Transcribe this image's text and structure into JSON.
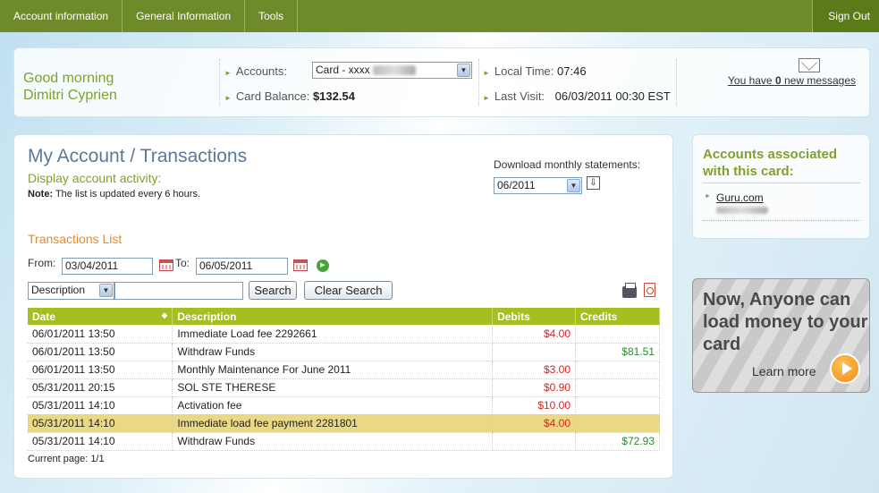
{
  "topnav": {
    "items": [
      "Account information",
      "General Information",
      "Tools"
    ],
    "signout": "Sign Out"
  },
  "infobar": {
    "greeting_line1": "Good morning",
    "greeting_line2": "Dimitri Cyprien",
    "accounts_label": "Accounts:",
    "accounts_value": "Card - xxxx",
    "balance_label": "Card Balance:",
    "balance_value": "$132.54",
    "local_time_label": "Local Time:",
    "local_time_value": "07:46",
    "last_visit_label": "Last Visit:",
    "last_visit_value": "06/03/2011 00:30 EST",
    "messages_prefix": "You have ",
    "messages_count": "0",
    "messages_suffix": " new messages"
  },
  "main": {
    "title": "My Account / Transactions",
    "subtitle": "Display account activity:",
    "note_label": "Note:",
    "note_text": " The list is updated every 6 hours.",
    "download_label": "Download monthly statements:",
    "download_month": "06/2011",
    "list_title": "Transactions List",
    "from_label": "From:",
    "from_value": "03/04/2011",
    "to_label": "To:",
    "to_value": "06/05/2011",
    "search_field_option": "Description",
    "search_value": "",
    "search_button": "Search",
    "clear_button": "Clear Search",
    "columns": [
      "Date",
      "Description",
      "Debits",
      "Credits"
    ],
    "rows": [
      {
        "date": "06/01/2011 13:50",
        "description": "Immediate Load fee 2292661",
        "debit": "$4.00",
        "credit": ""
      },
      {
        "date": "06/01/2011 13:50",
        "description": "Withdraw Funds",
        "debit": "",
        "credit": "$81.51"
      },
      {
        "date": "06/01/2011 13:50",
        "description": "Monthly Maintenance For June 2011",
        "debit": "$3.00",
        "credit": ""
      },
      {
        "date": "05/31/2011 20:15",
        "description": "SOL STE THERESE",
        "debit": "$0.90",
        "credit": ""
      },
      {
        "date": "05/31/2011 14:10",
        "description": "Activation fee",
        "debit": "$10.00",
        "credit": ""
      },
      {
        "date": "05/31/2011 14:10",
        "description": "Immediate load fee payment 2281801",
        "debit": "$4.00",
        "credit": ""
      },
      {
        "date": "05/31/2011 14:10",
        "description": "Withdraw Funds",
        "debit": "",
        "credit": "$72.93"
      }
    ],
    "pager": "Current page: 1/1"
  },
  "side": {
    "heading": "Accounts associated with this card:",
    "item": "Guru.com"
  },
  "promo": {
    "text": "Now, Anyone can load money to your card",
    "learn_more": "Learn more"
  },
  "colors": {
    "nav_green": "#6f8a2a",
    "accent_green": "#7ea22a",
    "header_green": "#a4bf1f",
    "orange": "#e58a2c",
    "debit_red": "#dd2222",
    "credit_green": "#2a8c2a",
    "highlight": "#e9d985"
  }
}
